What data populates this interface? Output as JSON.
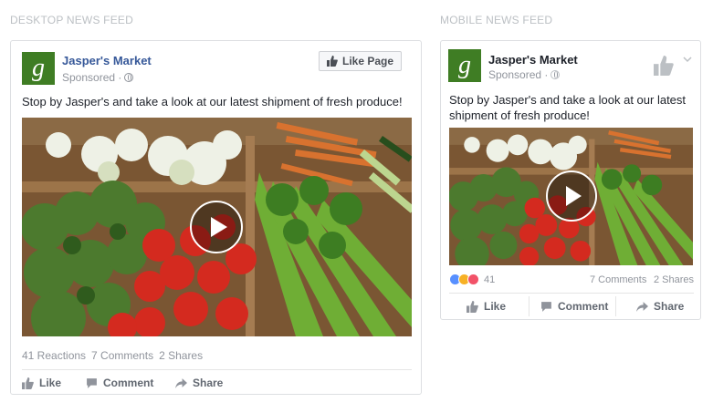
{
  "desktop": {
    "section_label": "DESKTOP NEWS FEED",
    "page_name": "Jasper's Market",
    "sponsored": "Sponsored ·",
    "like_page_label": "Like Page",
    "post_text": "Stop by Jasper's and take a look at our latest shipment of fresh produce!",
    "stats": {
      "reactions": "41 Reactions",
      "comments": "7 Comments",
      "shares": "2 Shares"
    },
    "actions": {
      "like": "Like",
      "comment": "Comment",
      "share": "Share"
    }
  },
  "mobile": {
    "section_label": "MOBILE NEWS FEED",
    "page_name": "Jasper's Market",
    "sponsored": "Sponsored ·",
    "post_text": "Stop by Jasper's and take a look at our latest shipment of fresh produce!",
    "reaction_count": "41",
    "comments": "7 Comments",
    "shares": "2 Shares",
    "actions": {
      "like": "Like",
      "comment": "Comment",
      "share": "Share"
    }
  },
  "icons": {
    "avatar": "jaspers-market-logo",
    "globe": "globe-icon",
    "thumbs_up": "thumbs-up-icon",
    "comment": "comment-icon",
    "share": "share-icon",
    "play": "play-icon",
    "chevron": "chevron-down-icon"
  },
  "colors": {
    "brand_blue": "#365899",
    "avatar_green": "#3f7d24",
    "muted_text": "#90949c"
  }
}
